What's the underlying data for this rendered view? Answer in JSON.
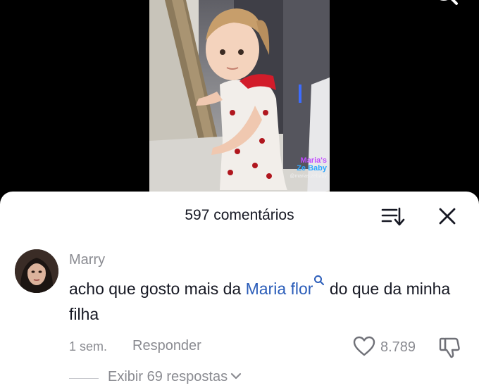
{
  "video": {
    "watermark": {
      "line1": "Maria's",
      "line2": "Ze Baby",
      "line3": "@marias.zebaby"
    }
  },
  "comments_header": {
    "title": "597 comentários"
  },
  "comment": {
    "username": "Marry",
    "text_before": "acho que gosto mais da ",
    "mention": "Maria flor",
    "text_after": " do que da minha filha",
    "date": "1 sem.",
    "reply_label": "Responder",
    "like_count": "8.789",
    "view_replies": "Exibir 69 respostas"
  },
  "icons": {
    "top_search": "search-icon",
    "sort": "sort-icon",
    "close": "close-icon",
    "mention_search": "search-icon",
    "like": "heart-icon",
    "dislike": "thumbs-down-icon",
    "expand": "chevron-down-icon"
  },
  "colors": {
    "mention": "#2b5db9",
    "text_primary": "#161823",
    "text_secondary": "#8a8b91"
  }
}
